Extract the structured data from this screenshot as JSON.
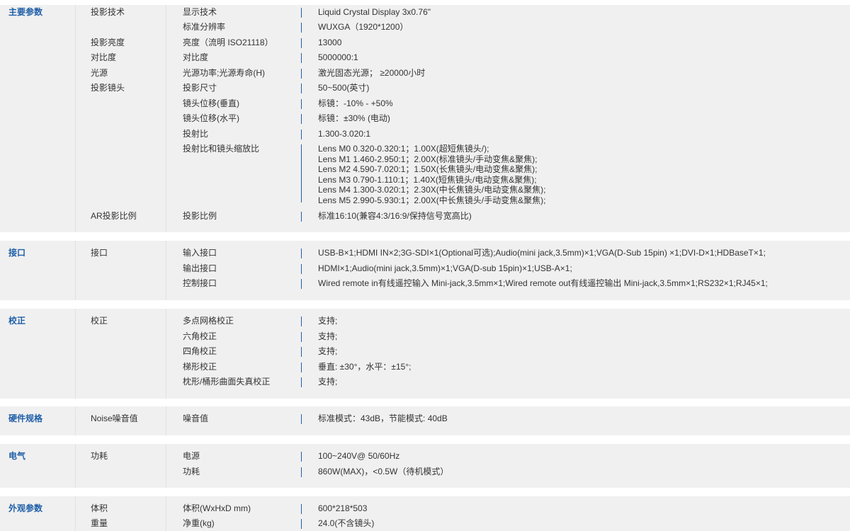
{
  "sections": [
    {
      "title": "主要参数",
      "rows": [
        {
          "cat": "投影技术",
          "item": "显示技术",
          "value": "Liquid Crystal Display  3x0.76\""
        },
        {
          "cat": "",
          "item": "标准分辨率",
          "value": "WUXGA（1920*1200）"
        },
        {
          "cat": "投影亮度",
          "item": "亮度（流明 ISO21118）",
          "value": "13000"
        },
        {
          "cat": "对比度",
          "item": "对比度",
          "value": "5000000:1"
        },
        {
          "cat": "光源",
          "item": "光源功率;光源寿命(H)",
          "value": "激光固态光源； ≥20000小时"
        },
        {
          "cat": "投影镜头",
          "item": "投影尺寸",
          "value": "50~500(英寸)"
        },
        {
          "cat": "",
          "item": "镜头位移(垂直)",
          "value": "标镜：-10% - +50%"
        },
        {
          "cat": "",
          "item": "镜头位移(水平)",
          "value": "标镜：±30% (电动)"
        },
        {
          "cat": "",
          "item": "投射比",
          "value": "1.300-3.020:1"
        },
        {
          "cat": "",
          "item": "投射比和镜头缩放比",
          "lines": [
            "Lens M0 0.320-0.320:1；1.00X(超短焦镜头/);",
            "Lens M1 1.460-2.950:1；2.00X(标准镜头/手动变焦&聚焦);",
            "Lens M2 4.590-7.020:1；1.50X(长焦镜头/电动变焦&聚焦);",
            "Lens M3 0.790-1.110:1；1.40X(短焦镜头/电动变焦&聚焦);",
            "Lens M4 1.300-3.020:1；2.30X(中长焦镜头/电动变焦&聚焦);",
            "Lens M5 2.990-5.930:1；2.00X(中长焦镜头/手动变焦&聚焦);"
          ]
        },
        {
          "cat": "AR投影比例",
          "item": "投影比例",
          "value": "标准16:10(兼容4:3/16:9/保持信号宽高比)"
        }
      ]
    },
    {
      "title": "接口",
      "rows": [
        {
          "cat": "接口",
          "item": "输入接口",
          "value": "USB-B×1;HDMI IN×2;3G-SDI×1(Optional可选);Audio(mini jack,3.5mm)×1;VGA(D-Sub 15pin)  ×1;DVI-D×1;HDBaseT×1;"
        },
        {
          "cat": "",
          "item": "输出接口",
          "value": "HDMI×1;Audio(mini jack,3.5mm)×1;VGA(D-sub 15pin)×1;USB-A×1;"
        },
        {
          "cat": "",
          "item": "控制接口",
          "value": "Wired remote in有线遥控输入 Mini-jack,3.5mm×1;Wired remote out有线遥控输出 Mini-jack,3.5mm×1;RS232×1;RJ45×1;"
        }
      ]
    },
    {
      "title": "校正",
      "rows": [
        {
          "cat": "校正",
          "item": "多点网格校正",
          "value": "支持;"
        },
        {
          "cat": "",
          "item": "六角校正",
          "value": "支持;"
        },
        {
          "cat": "",
          "item": "四角校正",
          "value": "支持;"
        },
        {
          "cat": "",
          "item": "梯形校正",
          "value": "垂直: ±30°，水平：±15°;"
        },
        {
          "cat": "",
          "item": "枕形/桶形曲面失真校正",
          "value": "支持;"
        }
      ]
    },
    {
      "title": "硬件规格",
      "rows": [
        {
          "cat": "Noise噪音值",
          "item": "噪音值",
          "value": "标准模式：43dB，节能模式: 40dB"
        }
      ]
    },
    {
      "title": "电气",
      "rows": [
        {
          "cat": "功耗",
          "item": "电源",
          "value": "100~240V@ 50/60Hz"
        },
        {
          "cat": "",
          "item": "功耗",
          "value": "860W(MAX)，<0.5W（待机模式）"
        }
      ]
    },
    {
      "title": "外观参数",
      "rows": [
        {
          "cat": "体积",
          "item": "体积(WxHxD mm)",
          "value": "600*218*503"
        },
        {
          "cat": "重量",
          "item": "净重(kg)",
          "value": "24.0(不含镜头)"
        }
      ]
    }
  ]
}
